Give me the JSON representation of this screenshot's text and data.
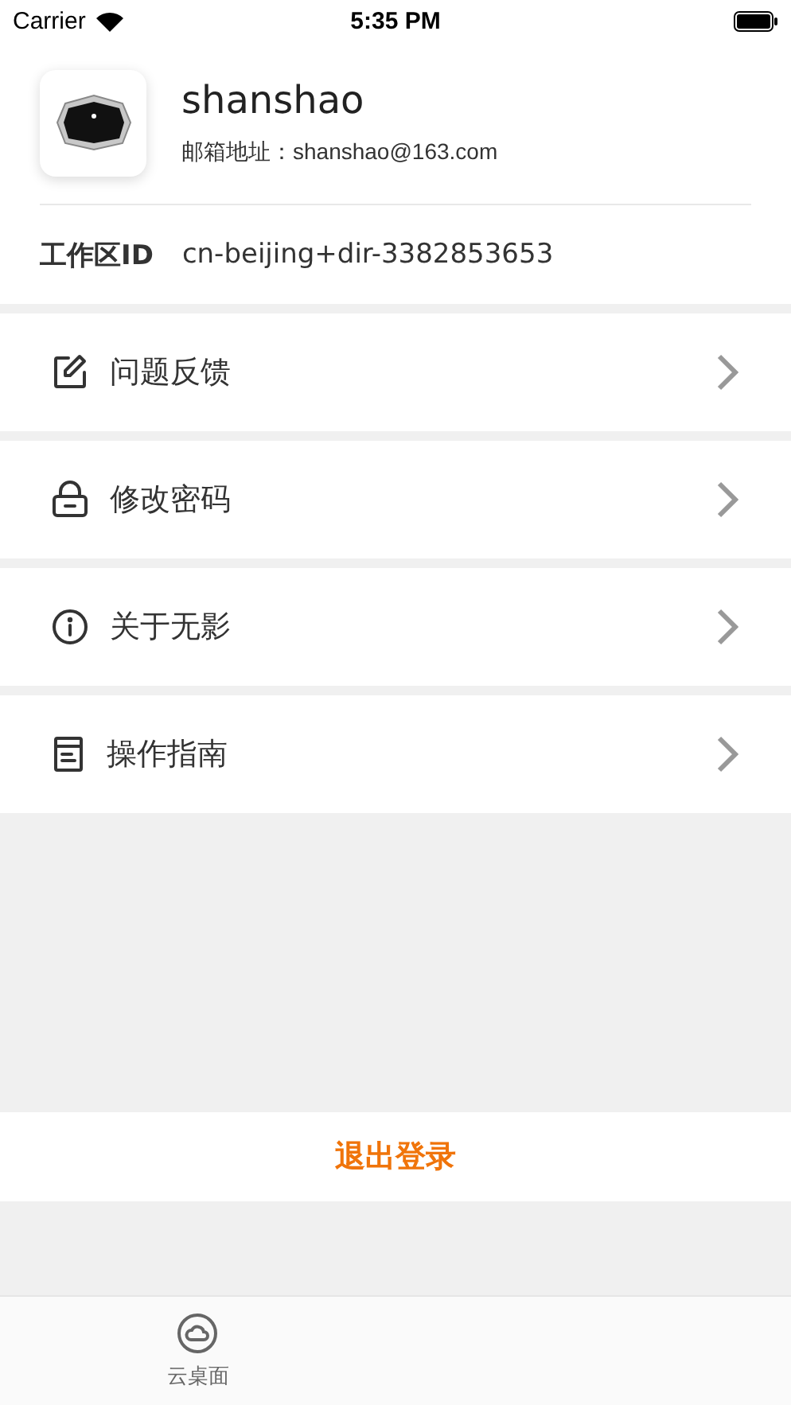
{
  "status_bar": {
    "carrier": "Carrier",
    "time": "5:35 PM"
  },
  "profile": {
    "name": "shanshao",
    "email_label": "邮箱地址：",
    "email": "shanshao@163.com"
  },
  "workspace": {
    "label": "工作区ID",
    "value": "cn-beijing+dir-3382853653"
  },
  "menu": [
    {
      "label": "问题反馈"
    },
    {
      "label": "修改密码"
    },
    {
      "label": "关于无影"
    },
    {
      "label": "操作指南"
    }
  ],
  "logout": "退出登录",
  "tabs": [
    {
      "label": "云桌面",
      "selected": false
    }
  ]
}
